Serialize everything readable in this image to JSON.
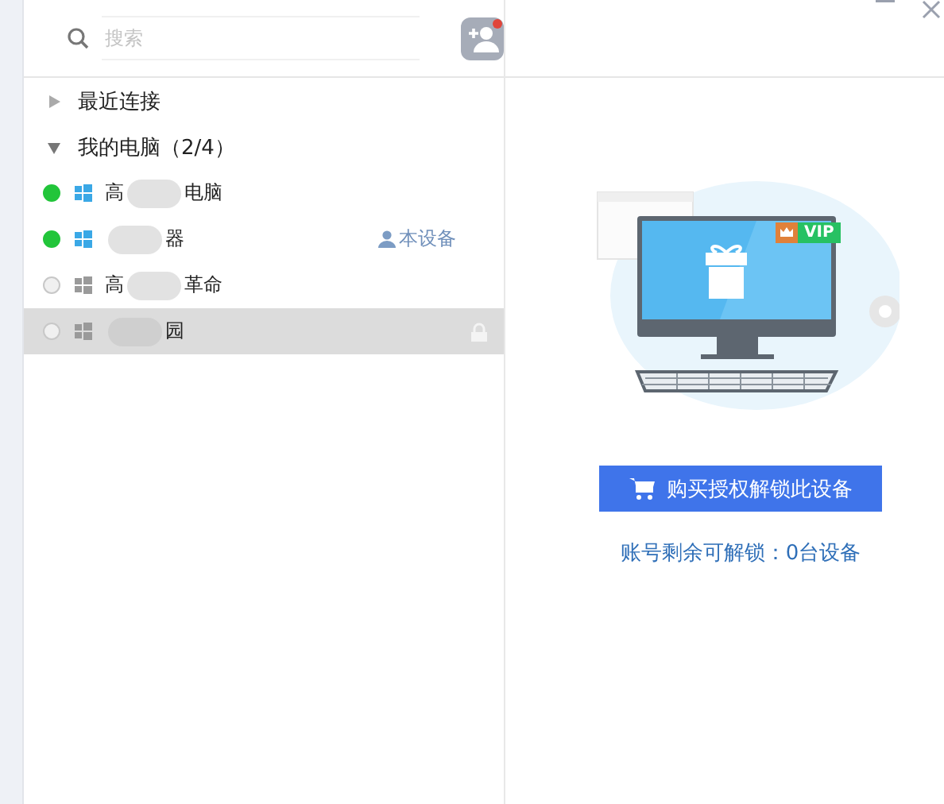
{
  "search": {
    "placeholder": "搜索"
  },
  "groups": [
    {
      "label": "最近连接",
      "expanded": false
    },
    {
      "label": "我的电脑（2/4）",
      "expanded": true
    }
  ],
  "devices": [
    {
      "name_start": "高",
      "name_end": "电脑",
      "online": true,
      "selected": false,
      "locked": false
    },
    {
      "name_end": "器",
      "online": true,
      "selected": false,
      "locked": false,
      "tag": "本设备"
    },
    {
      "name_start": "高",
      "name_end": "革命",
      "online": false,
      "selected": false,
      "locked": false
    },
    {
      "name_end": "园",
      "online": false,
      "selected": true,
      "locked": true
    }
  ],
  "promo": {
    "vip_badge": "VIP",
    "button": "购买授权解锁此设备",
    "note": "账号剩余可解锁：0台设备"
  }
}
